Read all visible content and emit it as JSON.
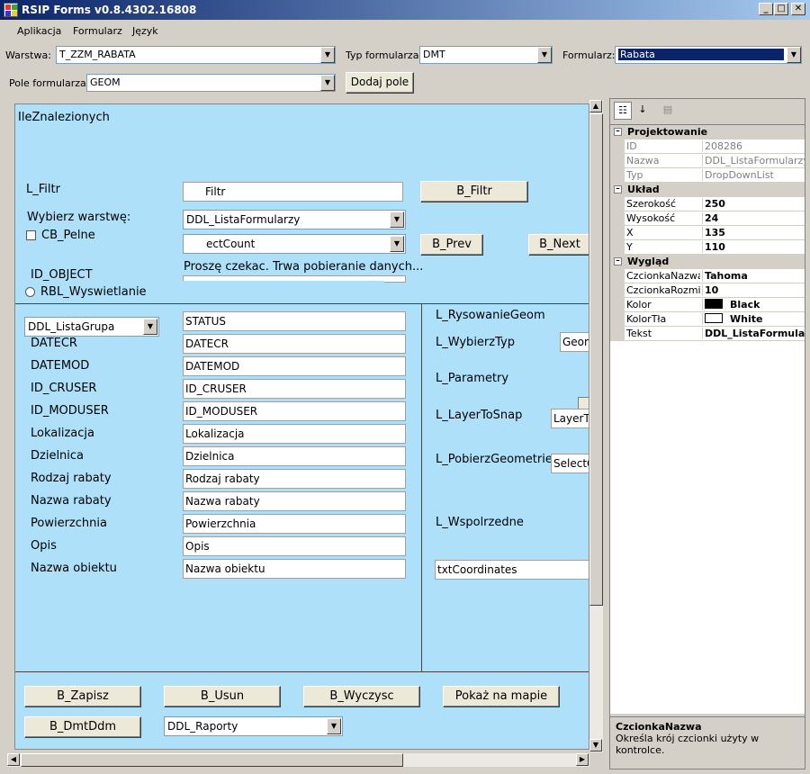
{
  "window": {
    "title": "RSIP Forms v0.8.4302.16808",
    "minimize": "_",
    "maximize": "□",
    "close": "✕"
  },
  "menu": [
    "Aplikacja",
    "Formularz",
    "Język"
  ],
  "toolbar": {
    "warstwa_label": "Warstwa:",
    "warstwa_value": "T_ZZM_RABATA",
    "typ_label": "Typ formularza:",
    "typ_value": "DMT",
    "formularz_label": "Formularz:",
    "formularz_value": "Rabata",
    "pole_label": "Pole formularza:",
    "pole_value": "GEOM",
    "dodaj_button": "Dodaj pole"
  },
  "canvas": {
    "ile_znalezionych": "IleZnalezionych",
    "l_filtr": "L_Filtr",
    "filtr_box": "Filtr",
    "b_filtr": "B_Filtr",
    "wybierz_warstwe": "Wybierz warstwę:",
    "ddl_lista_formularzy": "DDL_ListaFormularzy",
    "cb_pelne": "CB_Pelne",
    "select_count": "ectCount",
    "b_prev": "B_Prev",
    "b_next": "B_Next",
    "id_object": "ID_OBJECT",
    "prosze_czekac": "Proszę czekac. Trwa pobieranie danych...",
    "rbl_wyswietlanie": "RBL_Wyswietlanie",
    "ddl_lista_grupa": "DDL_ListaGrupa",
    "fields": [
      {
        "label": "",
        "value": "STATUS"
      },
      {
        "label": "DATECR",
        "value": "DATECR"
      },
      {
        "label": "DATEMOD",
        "value": "DATEMOD"
      },
      {
        "label": "ID_CRUSER",
        "value": "ID_CRUSER"
      },
      {
        "label": "ID_MODUSER",
        "value": "ID_MODUSER"
      },
      {
        "label": "Lokalizacja",
        "value": "Lokalizacja"
      },
      {
        "label": "Dzielnica",
        "value": "Dzielnica"
      },
      {
        "label": "Rodzaj rabaty",
        "value": "Rodzaj rabaty"
      },
      {
        "label": "Nazwa rabaty",
        "value": "Nazwa rabaty"
      },
      {
        "label": "Powierzchnia",
        "value": "Powierzchnia"
      },
      {
        "label": "Opis",
        "value": "Opis"
      },
      {
        "label": "Nazwa obiektu",
        "value": "Nazwa obiektu"
      }
    ],
    "right": {
      "l_rysowanie": "L_RysowanieGeom",
      "l_wybierz_typ": "L_WybierzTyp",
      "geom_combo": "Geom",
      "l_parametry": "L_Parametry",
      "l_layer_to_snap": "L_LayerToSnap",
      "layer_combo": "LayerT",
      "l_pobierz": "L_PobierzGeometrie",
      "select_combo": "SelectG",
      "l_wspolrzedne": "L_Wspolrzedne",
      "txt_coordinates": "txtCoordinates"
    },
    "buttons": {
      "zapisz": "B_Zapisz",
      "usun": "B_Usun",
      "wyczysc": "B_Wyczysc",
      "pokaz": "Pokaż na mapie",
      "dmtddm": "B_DmtDdm",
      "ddl_raporty": "DDL_Raporty"
    }
  },
  "propgrid": {
    "categories": {
      "projektowanie": "Projektowanie",
      "uklad": "Układ",
      "wyglad": "Wygląd"
    },
    "projektowanie": [
      {
        "k": "ID",
        "v": "208286"
      },
      {
        "k": "Nazwa",
        "v": "DDL_ListaFormularzy"
      },
      {
        "k": "Typ",
        "v": "DropDownList"
      }
    ],
    "uklad": [
      {
        "k": "Szerokość",
        "v": "250"
      },
      {
        "k": "Wysokość",
        "v": "24"
      },
      {
        "k": "X",
        "v": "135"
      },
      {
        "k": "Y",
        "v": "110"
      }
    ],
    "wyglad": [
      {
        "k": "CzcionkaNazwa",
        "v": "Tahoma"
      },
      {
        "k": "CzcionkaRozmia",
        "v": "10"
      },
      {
        "k": "Kolor",
        "v": "Black"
      },
      {
        "k": "KolorTła",
        "v": "White"
      },
      {
        "k": "Tekst",
        "v": "DDL_ListaFormularzy"
      }
    ],
    "desc_title": "CzcionkaNazwa",
    "desc_text": "Określa krój czcionki użyty w kontrolce.",
    "colors": {
      "kolor": "#000000",
      "kolor_tla": "#ffffff"
    }
  }
}
